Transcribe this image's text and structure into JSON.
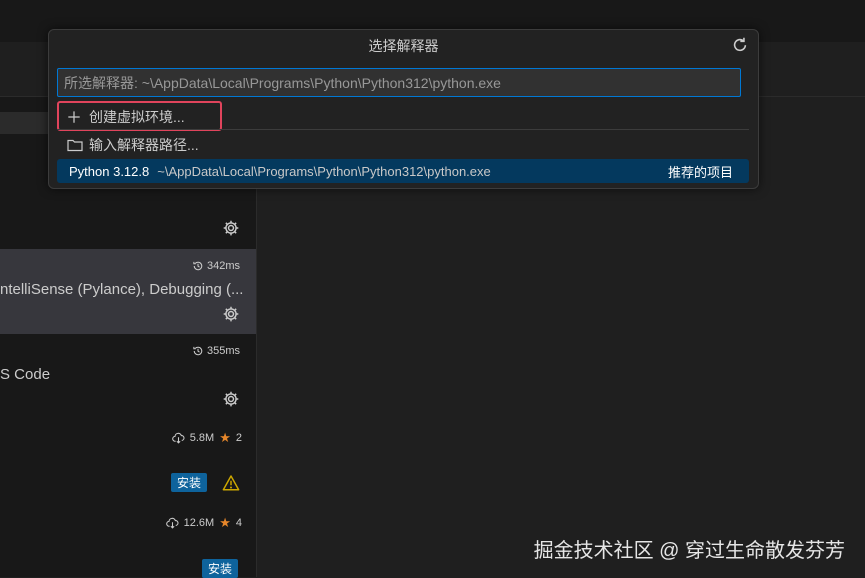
{
  "quick_pick": {
    "title": "选择解释器",
    "input_placeholder": "所选解释器: ~\\AppData\\Local\\Programs\\Python\\Python312\\python.exe",
    "create_env_label": "创建虚拟环境...",
    "enter_path_label": "输入解释器路径...",
    "interpreter": {
      "name": "Python 3.12.8",
      "path": "~\\AppData\\Local\\Programs\\Python\\Python312\\python.exe",
      "badge": "推荐的项目"
    }
  },
  "extensions": [
    {
      "time": "342ms",
      "desc": "ntelliSense (Pylance), Debugging (..."
    },
    {
      "time": "355ms",
      "desc": "S Code"
    },
    {
      "downloads": "5.8M",
      "rating": "2",
      "install_label": "安装"
    },
    {
      "downloads": "12.6M",
      "rating": "4",
      "install_label": "安装"
    }
  ],
  "watermark": "掘金技术社区 @ 穿过生命散发芬芳",
  "colors": {
    "accent": "#0078d4",
    "selection": "#04395e",
    "highlight_box": "#e0445c",
    "star": "#e5862a",
    "install_button": "#0e639c",
    "warning": "#cca700"
  }
}
